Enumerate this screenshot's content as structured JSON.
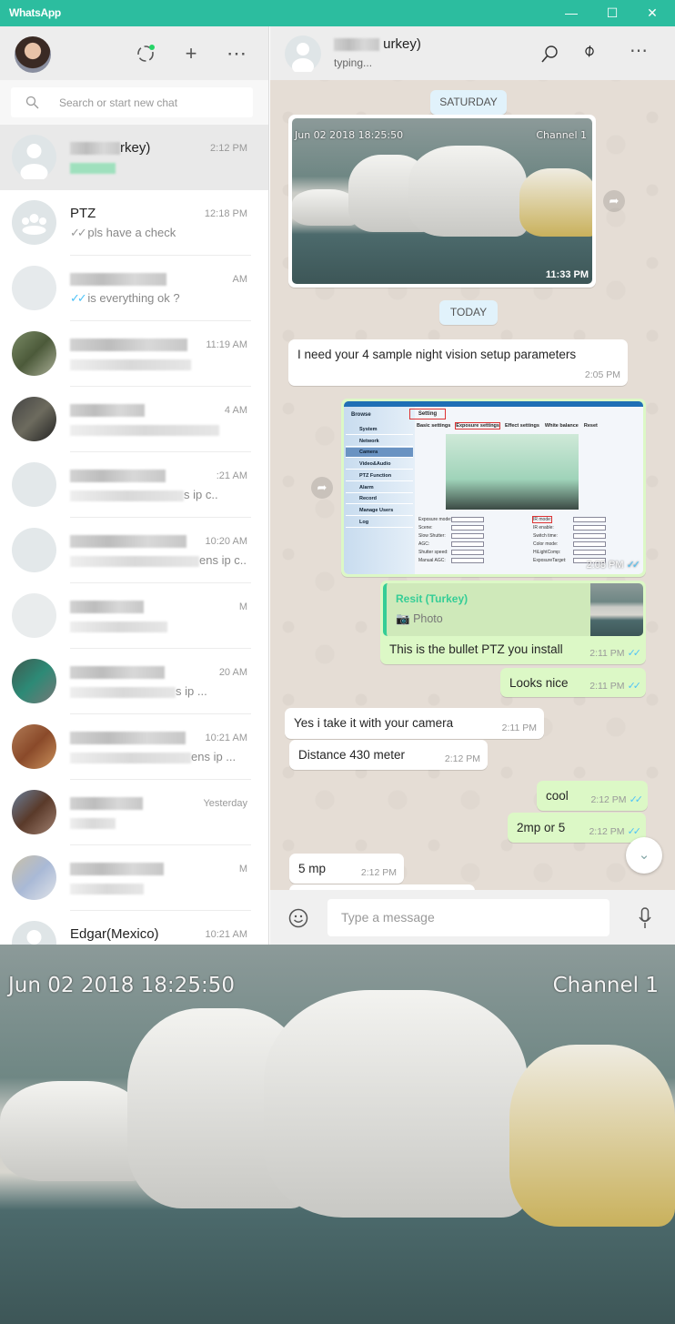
{
  "window": {
    "title": "WhatsApp",
    "minimize": "—",
    "maximize": "☐",
    "close": "✕"
  },
  "sidebar": {
    "header": {
      "status_icon": "status-icon",
      "new_chat_icon": "+",
      "menu_icon": "⋯"
    },
    "search": {
      "placeholder": "Search or start new chat",
      "icon": "🔍"
    },
    "chats": [
      {
        "name": "rkey)",
        "time": "2:12 PM",
        "preview": "",
        "selected": true
      },
      {
        "name": "PTZ",
        "time": "12:18 PM",
        "preview": "pls have a check",
        "ticks": "✓✓"
      },
      {
        "name": "",
        "time": "AM",
        "preview": "is everything ok ?",
        "ticks": "✓✓"
      },
      {
        "name": "",
        "time": "11:19 AM",
        "preview": ""
      },
      {
        "name": "",
        "time": "4 AM",
        "preview": ""
      },
      {
        "name": "",
        "time": ":21 AM",
        "preview": "s ip c.."
      },
      {
        "name": "",
        "time": "10:20 AM",
        "preview": "ens ip c.."
      },
      {
        "name": "",
        "time": "M",
        "preview": ""
      },
      {
        "name": "",
        "time": "20 AM",
        "preview": "s ip ..."
      },
      {
        "name": "",
        "time": "10:21 AM",
        "preview": "ens ip ..."
      },
      {
        "name": "",
        "time": "Yesterday",
        "preview": ""
      },
      {
        "name": "",
        "time": "M",
        "preview": ""
      },
      {
        "name": "Edgar(Mexico)",
        "time": "10:21 AM",
        "preview": ""
      }
    ]
  },
  "conversation": {
    "header": {
      "name": "urkey)",
      "status": "typing...",
      "search_icon": "⚲",
      "attach_icon": "📎",
      "menu_icon": "⋯"
    },
    "day_saturday": "SATURDAY",
    "day_today": "TODAY",
    "image_msg": {
      "osd_date": "Jun 02 2018 18:25:50",
      "osd_channel": "Channel 1",
      "time": "11:33 PM"
    },
    "messages": [
      {
        "text": "I need your 4 sample night vision setup parameters",
        "time": "2:05 PM"
      },
      {
        "text": "This is the bullet PTZ you install",
        "time": "2:11 PM",
        "ticks": "✓✓",
        "reply": {
          "author": "Resit (Turkey)",
          "label": "Photo"
        }
      },
      {
        "text": "Looks nice",
        "time": "2:11 PM",
        "ticks": "✓✓"
      },
      {
        "text": "Yes i take it with your camera",
        "time": "2:11 PM"
      },
      {
        "text": "Distance 430 meter",
        "time": "2:12 PM"
      },
      {
        "text": "cool",
        "time": "2:12 PM",
        "ticks": "✓✓"
      },
      {
        "text": "2mp or 5",
        "time": "2:12 PM",
        "ticks": "✓✓"
      },
      {
        "text": "5 mp",
        "time": "2:12 PM"
      }
    ],
    "screenshot_msg": {
      "time": "2:08 PM",
      "ticks": "✓✓",
      "tabs": [
        "Browse",
        "Setting"
      ],
      "subtabs": [
        "Basic settings",
        "Exposure settings",
        "Effect settings",
        "White balance",
        "Reset"
      ],
      "menu": [
        "System",
        "Network",
        "Camera",
        "Video&Audio",
        "PTZ Function",
        "Alarm",
        "Record",
        "Manage Users",
        "Log"
      ],
      "fields": [
        "Exposure mode:",
        "Scene:",
        "Slow Shutter:",
        "AGC:",
        "Shutter speed:",
        "Manual AGC:",
        "IR mode:",
        "IR enable:",
        "Switch time:",
        "Color mode:",
        "HiLightComp:",
        "ExposureTarget:"
      ]
    },
    "composer": {
      "placeholder": "Type a message",
      "emoji_icon": "☺",
      "mic_icon": "🎤"
    }
  },
  "bottom_photo": {
    "osd_date": "Jun 02 2018 18:25:50",
    "osd_channel": "Channel 1"
  },
  "colors": {
    "titlebar": "#2cbd9f",
    "outgoing": "#dcf8c6",
    "incoming": "#ffffff",
    "chat_bg": "#e5ddd5",
    "tick_read": "#4fc3f7",
    "quote_author": "#35cd96"
  }
}
